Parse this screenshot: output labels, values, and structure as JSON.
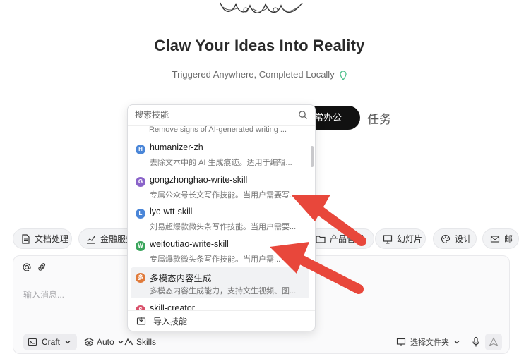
{
  "hero": {
    "title": "Claw Your Ideas Into Reality",
    "tagline": "Triggered Anywhere, Completed Locally"
  },
  "mode_switch": {
    "active_label": "常办公",
    "other_label": "任务"
  },
  "skill_dropdown": {
    "search_placeholder": "搜索技能",
    "partial_top_desc": "Remove signs of AI-generated writing ...",
    "items": [
      {
        "avatar": "H",
        "avatar_color": "#4a86d8",
        "name": "humanizer-zh",
        "desc": "去除文本中的 AI 生成痕迹。适用于编辑..."
      },
      {
        "avatar": "G",
        "avatar_color": "#8a63c9",
        "name": "gongzhonghao-write-skill",
        "desc": "专属公众号长文写作技能。当用户需要写..."
      },
      {
        "avatar": "L",
        "avatar_color": "#4a86d8",
        "name": "lyc-wtt-skill",
        "desc": "刘易超爆款微头条写作技能。当用户需要..."
      },
      {
        "avatar": "W",
        "avatar_color": "#3aa55c",
        "name": "weitoutiao-write-skill",
        "desc": "专属爆款微头条写作技能。当用户需..."
      },
      {
        "avatar": "多",
        "avatar_color": "#e07a3a",
        "name": "多模态内容生成",
        "desc": "多模态内容生成能力，支持文生视频、图..."
      },
      {
        "avatar": "S",
        "avatar_color": "#d9506a",
        "name": "skill-creator",
        "desc": ""
      }
    ],
    "footer_label": "导入技能"
  },
  "category_chips": [
    {
      "icon": "document-icon",
      "label": "文档处理"
    },
    {
      "icon": "finance-chart-icon",
      "label": "金融服务"
    },
    {
      "icon": "folder-icon",
      "label": "产品管理"
    },
    {
      "icon": "slides-icon",
      "label": "幻灯片"
    },
    {
      "icon": "palette-icon",
      "label": "设计"
    },
    {
      "icon": "mail-icon",
      "label": "邮"
    }
  ],
  "composer": {
    "placeholder": "输入消息...",
    "craft_label": "Craft",
    "auto_label": "Auto",
    "skills_label": "Skills",
    "folder_label": "选择文件夹"
  },
  "colors": {
    "arrow": "#e8473b",
    "accent_dark": "#111111",
    "pin_green": "#4bbf8a"
  }
}
